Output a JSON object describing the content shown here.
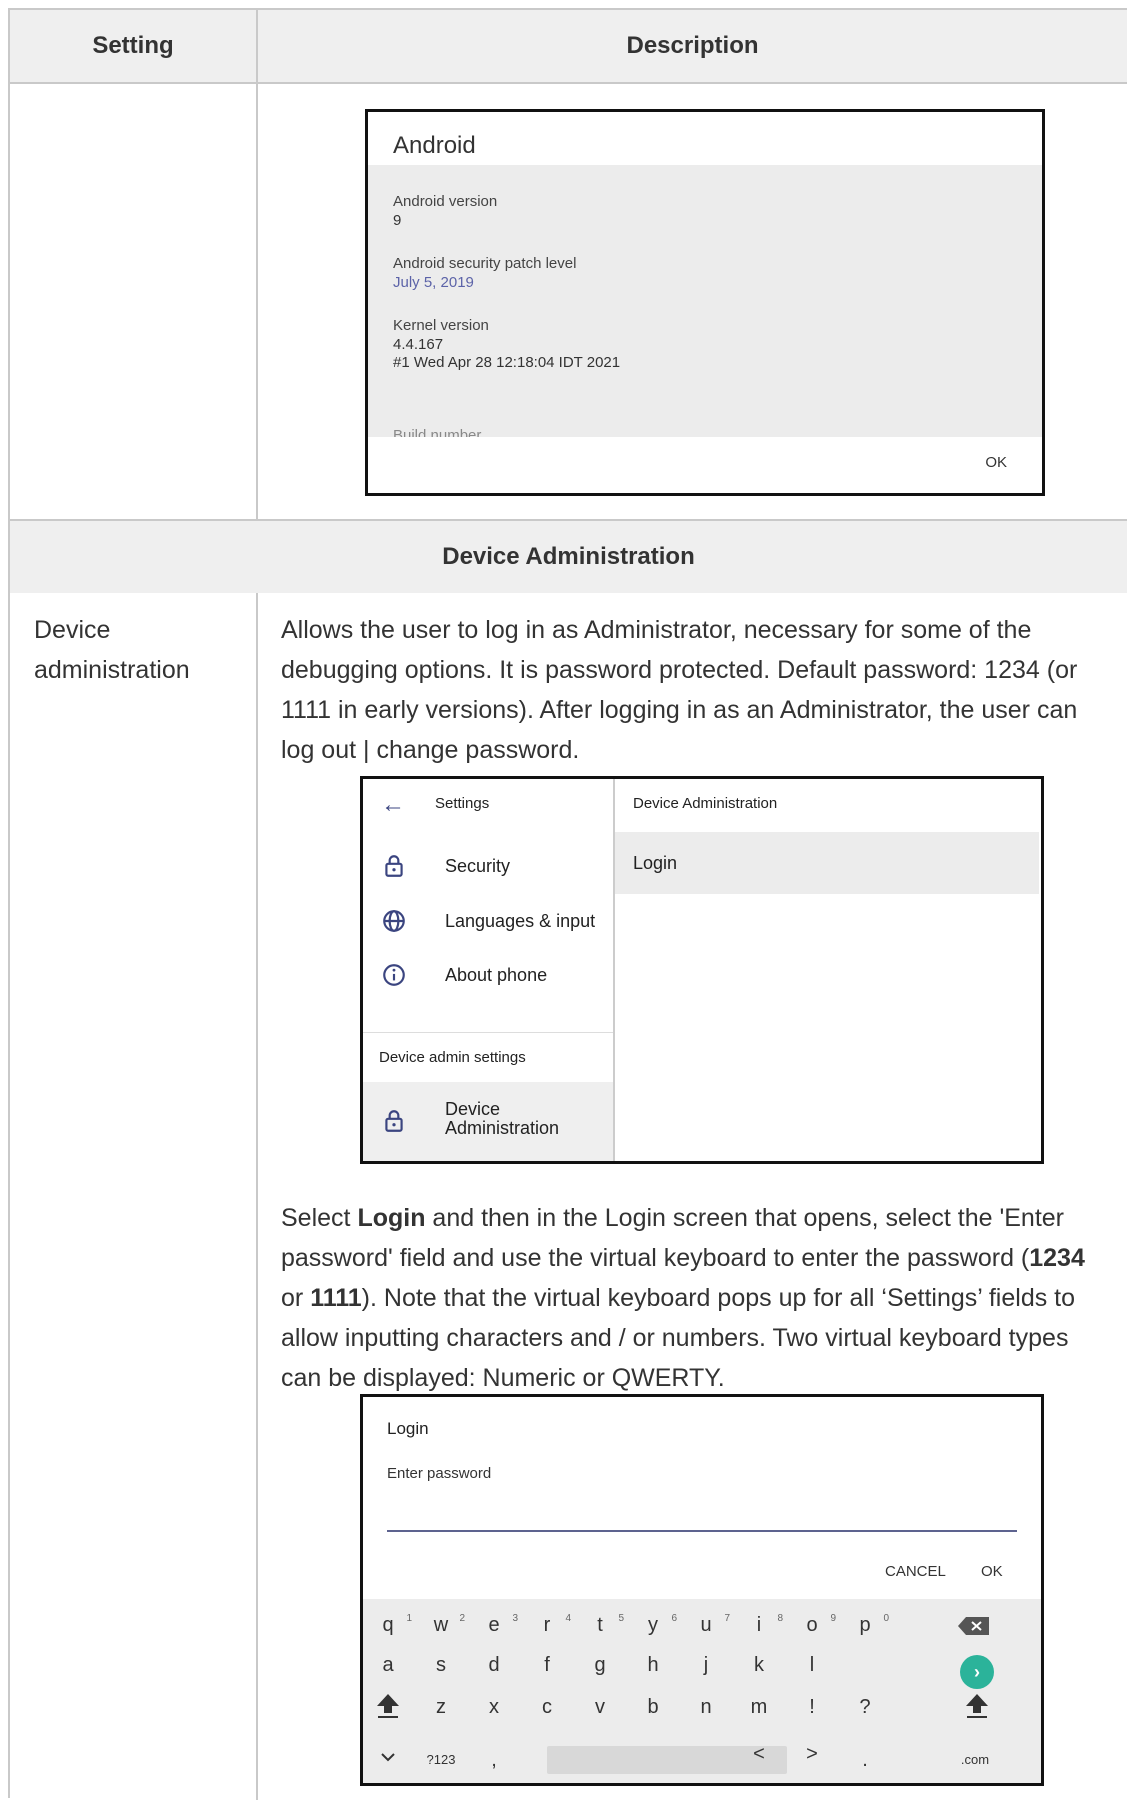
{
  "table": {
    "col_setting": "Setting",
    "col_description": "Description",
    "section_title": "Device Administration"
  },
  "android_dialog": {
    "title": "Android",
    "version_label": "Android version",
    "version_value": "9",
    "patch_label": "Android security patch level",
    "patch_value": "July 5, 2019",
    "kernel_label": "Kernel version",
    "kernel_value_1": "4.4.167",
    "kernel_value_2": "#1 Wed Apr 28 12:18:04 IDT 2021",
    "build_label": "Build number",
    "ok_label": "OK"
  },
  "device_admin": {
    "setting_name": "Device administration",
    "paragraph_1": "Allows the user to log in as Administrator, necessary for some of the debugging options. It is password protected. Default password: 1234 (or 1111 in early versions). After logging in as an Administrator, the user can log out | change password.",
    "p2_before_login": "Select ",
    "p2_login_bold": "Login",
    "p2_after_login": " and then in the Login screen that opens, select the 'Enter password' field and use the virtual keyboard to enter the password (",
    "p2_pw1": "1234",
    "p2_or": " or ",
    "p2_pw2": "1111",
    "p2_rest": "). Note that the virtual keyboard pops up for all ‘Settings’ fields to allow inputting characters and / or numbers. Two virtual keyboard types can be displayed: Numeric or QWERTY."
  },
  "settings_screen": {
    "back_icon": "arrow-left-icon",
    "title": "Settings",
    "items": [
      {
        "label": "Security",
        "icon": "lock-icon"
      },
      {
        "label": "Languages & input",
        "icon": "globe-icon"
      },
      {
        "label": "About phone",
        "icon": "info-icon"
      }
    ],
    "admin_header": "Device admin settings",
    "admin_item_line1": "Device",
    "admin_item_line2": "Administration",
    "right_title": "Device Administration",
    "right_login": "Login"
  },
  "login_screen": {
    "title": "Login",
    "field_label": "Enter password",
    "cancel_label": "CANCEL",
    "ok_label": "OK",
    "keyboard": {
      "row1": [
        "q",
        "w",
        "e",
        "r",
        "t",
        "y",
        "u",
        "i",
        "o",
        "p"
      ],
      "row1_hints": [
        "1",
        "2",
        "3",
        "4",
        "5",
        "6",
        "7",
        "8",
        "9",
        "0"
      ],
      "row2": [
        "a",
        "s",
        "d",
        "f",
        "g",
        "h",
        "j",
        "k",
        "l"
      ],
      "row3": [
        "z",
        "x",
        "c",
        "v",
        "b",
        "n",
        "m",
        "!",
        "?"
      ],
      "row4_left": [
        "?123",
        ","
      ],
      "row4_right": [
        "<",
        ">",
        ".",
        ".com"
      ],
      "backspace_icon": "backspace-icon",
      "shift_icon": "shift-icon",
      "enter_icon": "next-arrow-icon",
      "collapse_icon": "chevron-down-icon"
    }
  }
}
